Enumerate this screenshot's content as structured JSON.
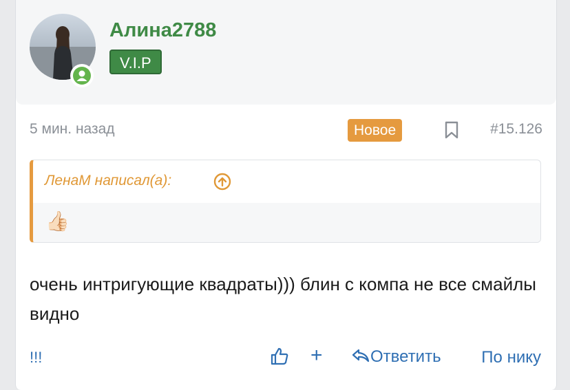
{
  "post": {
    "author": {
      "name": "Алина2788",
      "badge": "V.I.P",
      "online": true
    },
    "time": "5 мин. назад",
    "new_label": "Новое",
    "number": "#15.126",
    "quote": {
      "header": "ЛенаМ написал(а):",
      "emoji": "👍🏻"
    },
    "message": "очень интригующие квадраты))) блин с компа не все смайлы видно",
    "footer": {
      "left_label": "!!!",
      "plus_label": "+",
      "reply_label": "Ответить",
      "nick_label": "По нику"
    }
  },
  "colors": {
    "accent_green": "#3f8a46",
    "accent_orange": "#e59a3f",
    "link_blue": "#2f6fb3"
  },
  "icons": [
    "user-avatar",
    "online-indicator-icon",
    "bookmark-icon",
    "arrow-up-circle-icon",
    "like-icon",
    "reply-icon"
  ]
}
